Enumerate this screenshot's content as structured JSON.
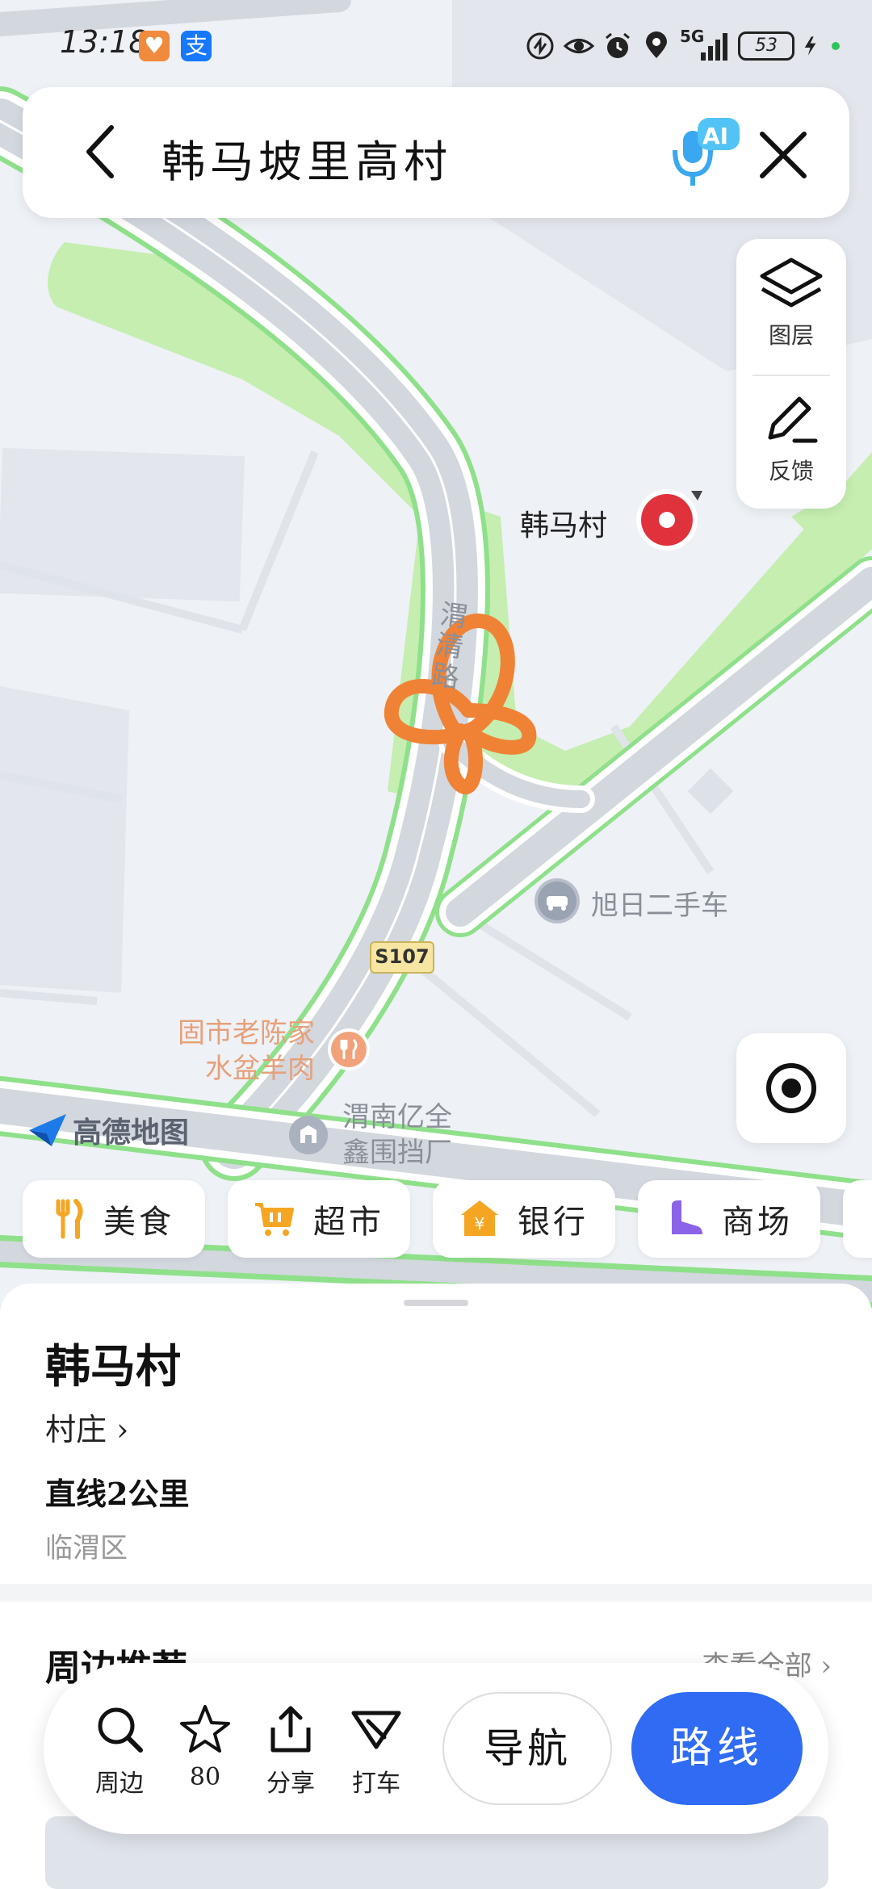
{
  "status_bar": {
    "time": "13:18",
    "network": "5G",
    "battery": "53"
  },
  "search": {
    "title": "韩马坡里高村",
    "ai_badge": "AI"
  },
  "tools": {
    "layers_label": "图层",
    "feedback_label": "反馈"
  },
  "map": {
    "poi_village": "韩马村",
    "road_name": "渭清路",
    "poi_car": "旭日二手车",
    "road_code": "S107",
    "poi_food_line1": "固市老陈家",
    "poi_food_line2": "水盆羊肉",
    "poi_factory_line1": "渭南亿全",
    "poi_factory_line2": "鑫围挡厂",
    "watermark": "高德地图"
  },
  "chips": [
    {
      "label": "美食",
      "icon": "fork-knife-icon",
      "color": "#f4a623"
    },
    {
      "label": "超市",
      "icon": "cart-icon",
      "color": "#f4a623"
    },
    {
      "label": "银行",
      "icon": "bank-icon",
      "color": "#f4a623"
    },
    {
      "label": "商场",
      "icon": "mall-icon",
      "color": "#8a63e8"
    }
  ],
  "place": {
    "name": "韩马村",
    "category": "村庄 ›",
    "distance": "直线2公里",
    "district": "临渭区"
  },
  "nearby": {
    "title": "周边推荐",
    "all": "查看全部 ›"
  },
  "actions": {
    "nearby": "周边",
    "favorite": "80",
    "share": "分享",
    "taxi": "打车",
    "navigate": "导航",
    "route": "路线"
  },
  "colors": {
    "accent": "#2f6bf3",
    "pin": "#e0323c",
    "road_green": "#8fe08a",
    "park": "#c5eeb0"
  }
}
